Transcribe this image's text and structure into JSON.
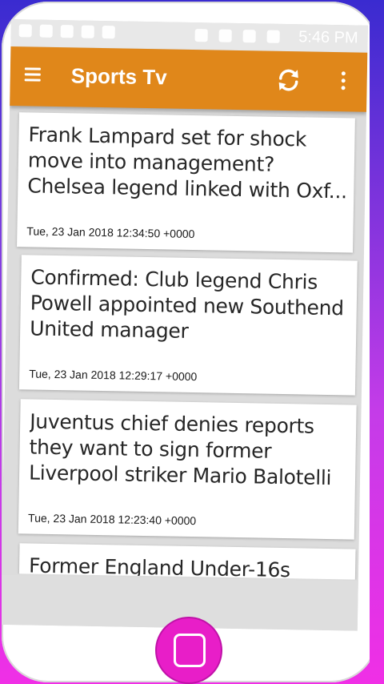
{
  "status_bar": {
    "time": "5:46 PM"
  },
  "app_bar": {
    "title": "Sports Tv",
    "menu_icon": "hamburger-menu-icon",
    "refresh_icon": "refresh-icon",
    "more_icon": "more-vert-icon"
  },
  "news": [
    {
      "title": "Frank Lampard set for shock move into management? Chelsea legend linked with Oxf...",
      "date": "Tue, 23 Jan 2018 12:34:50 +0000"
    },
    {
      "title": "Confirmed: Club legend Chris Powell appointed new Southend United manager",
      "date": "Tue, 23 Jan 2018 12:29:17 +0000"
    },
    {
      "title": "Juventus chief denies reports they want to sign former Liverpool striker Mario Balotelli",
      "date": "Tue, 23 Jan 2018 12:23:40 +0000"
    },
    {
      "title": "Former England Under-16s",
      "date": ""
    }
  ],
  "colors": {
    "app_bar": "#e0871a",
    "home_button": "#e81ec8"
  }
}
